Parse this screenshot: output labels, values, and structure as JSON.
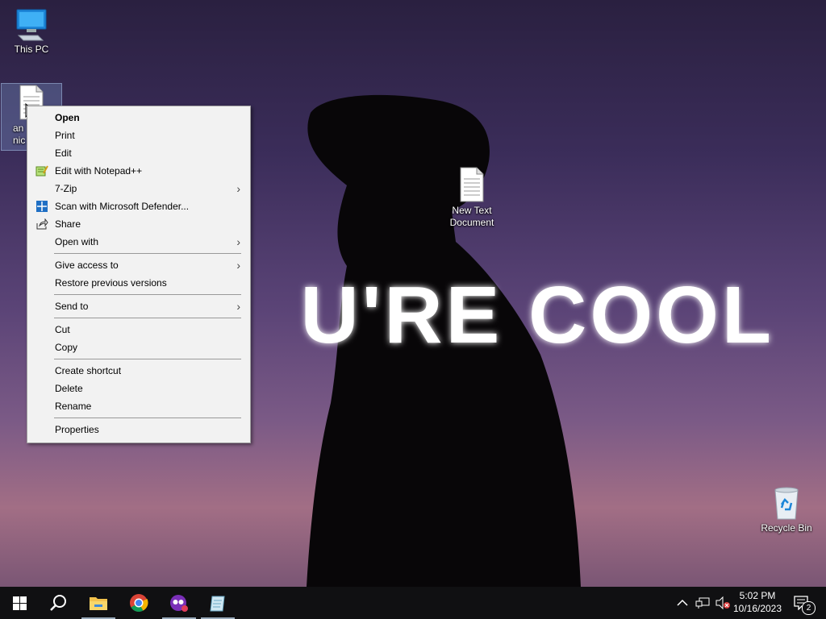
{
  "wallpaper": {
    "text": "U'RE COOL"
  },
  "desktop": {
    "icons": [
      {
        "label": "This PC"
      },
      {
        "label_line1": "an",
        "label_line2": "nic"
      },
      {
        "label_line1": "New Text",
        "label_line2": "Document"
      },
      {
        "label": "Recycle Bin"
      }
    ]
  },
  "context_menu": {
    "items": [
      {
        "label": "Open"
      },
      {
        "label": "Print"
      },
      {
        "label": "Edit"
      },
      {
        "label": "Edit with Notepad++"
      },
      {
        "label": "7-Zip"
      },
      {
        "label": "Scan with Microsoft Defender..."
      },
      {
        "label": "Share"
      },
      {
        "label": "Open with"
      },
      {
        "label": "Give access to"
      },
      {
        "label": "Restore previous versions"
      },
      {
        "label": "Send to"
      },
      {
        "label": "Cut"
      },
      {
        "label": "Copy"
      },
      {
        "label": "Create shortcut"
      },
      {
        "label": "Delete"
      },
      {
        "label": "Rename"
      },
      {
        "label": "Properties"
      }
    ]
  },
  "taskbar": {
    "clock": {
      "time": "5:02 PM",
      "date": "10/16/2023"
    },
    "notification_count": "2"
  },
  "colors": {
    "menu_bg": "#f2f2f2",
    "taskbar_bg": "#101012",
    "accent": "#0078d7"
  }
}
